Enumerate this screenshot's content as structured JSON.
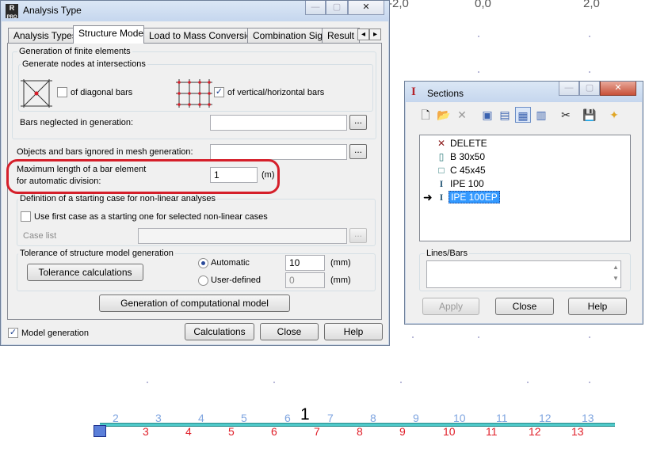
{
  "canvas": {
    "axis_labels": [
      "-2,0",
      "0,0",
      "2,0"
    ],
    "center_label": "1",
    "node_numbers": [
      "2",
      "3",
      "4",
      "5",
      "6",
      "7",
      "8",
      "9",
      "10",
      "11",
      "12",
      "13"
    ],
    "bar_numbers": [
      "3",
      "4",
      "5",
      "6",
      "7",
      "8",
      "9",
      "10",
      "11",
      "12",
      "13"
    ]
  },
  "analysis_window": {
    "title": "Analysis Type",
    "app_icon_text": "R",
    "tabs": [
      "Analysis Types",
      "Structure Model",
      "Load to Mass Conversion",
      "Combination Sign",
      "Result R"
    ],
    "active_tab": "Structure Model",
    "generation": {
      "group_title": "Generation of finite elements",
      "nodes_group_title": "Generate nodes at intersections",
      "diagonal_label": "of diagonal bars",
      "diagonal_checked": false,
      "vertical_label": "of vertical/horizontal bars",
      "vertical_checked": true,
      "bars_neglected_label": "Bars neglected in generation:",
      "bars_neglected_value": ""
    },
    "objects_ignored_label": "Objects and bars ignored in mesh generation:",
    "objects_ignored_value": "",
    "max_length": {
      "label_line1": "Maximum length of a bar element",
      "label_line2": "for automatic division:",
      "value": "1",
      "unit": "(m)"
    },
    "nonlinear": {
      "group_title": "Definition of a starting case for non-linear analyses",
      "checkbox_label": "Use first case as a starting one for selected non-linear cases",
      "checked": false,
      "case_list_label": "Case list",
      "case_list_value": ""
    },
    "tolerance": {
      "group_title": "Tolerance of structure model generation",
      "calc_button": "Tolerance calculations",
      "automatic_label": "Automatic",
      "automatic_value": "10",
      "user_label": "User-defined",
      "user_value": "0",
      "unit": "(mm)",
      "selected": "automatic"
    },
    "generate_button": "Generation of computational model",
    "model_generation_label": "Model generation",
    "model_generation_checked": true,
    "buttons": {
      "calculations": "Calculations",
      "close": "Close",
      "help": "Help"
    },
    "tab_scroll": {
      "left": "◂",
      "right": "▸"
    }
  },
  "sections_window": {
    "title": "Sections",
    "app_icon_text": "I",
    "toolbar_icons": [
      "new-icon",
      "open-icon",
      "delete-icon",
      "view-icon-1",
      "view-icon-2",
      "view-icon-3",
      "view-icon-4",
      "cut-icon",
      "save-icon",
      "folder-star-icon"
    ],
    "items": [
      {
        "icon": "✕",
        "label": "DELETE"
      },
      {
        "icon": "▯",
        "label": "B 30x50"
      },
      {
        "icon": "□",
        "label": "C 45x45"
      },
      {
        "icon": "I",
        "label": "IPE 100"
      },
      {
        "icon": "I",
        "label": "IPE 100EP"
      }
    ],
    "selected_index": 4,
    "pointer": "➜",
    "lines_bars_title": "Lines/Bars",
    "lines_bars_value": "",
    "buttons": {
      "apply": "Apply",
      "close": "Close",
      "help": "Help"
    }
  },
  "colors": {
    "beam": "#4fc9c9",
    "highlight_ring": "#d51f2a",
    "node_numbers": "#7fa5e0",
    "bar_numbers": "#e0202a",
    "selection": "#3399ff"
  }
}
